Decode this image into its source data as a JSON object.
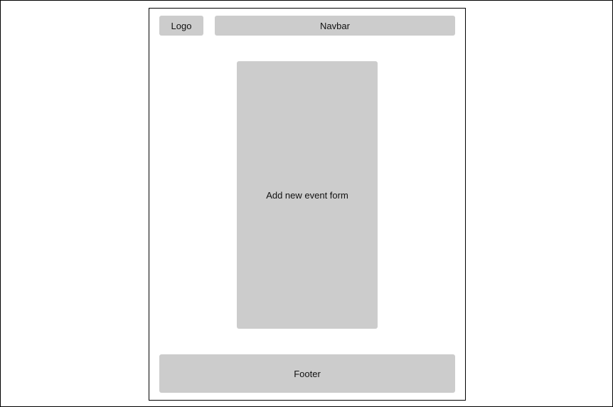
{
  "header": {
    "logo_label": "Logo",
    "navbar_label": "Navbar"
  },
  "main": {
    "form_label": "Add new event form"
  },
  "footer": {
    "label": "Footer"
  },
  "colors": {
    "placeholder_fill": "#cccccc",
    "border": "#000000",
    "background": "#ffffff"
  }
}
